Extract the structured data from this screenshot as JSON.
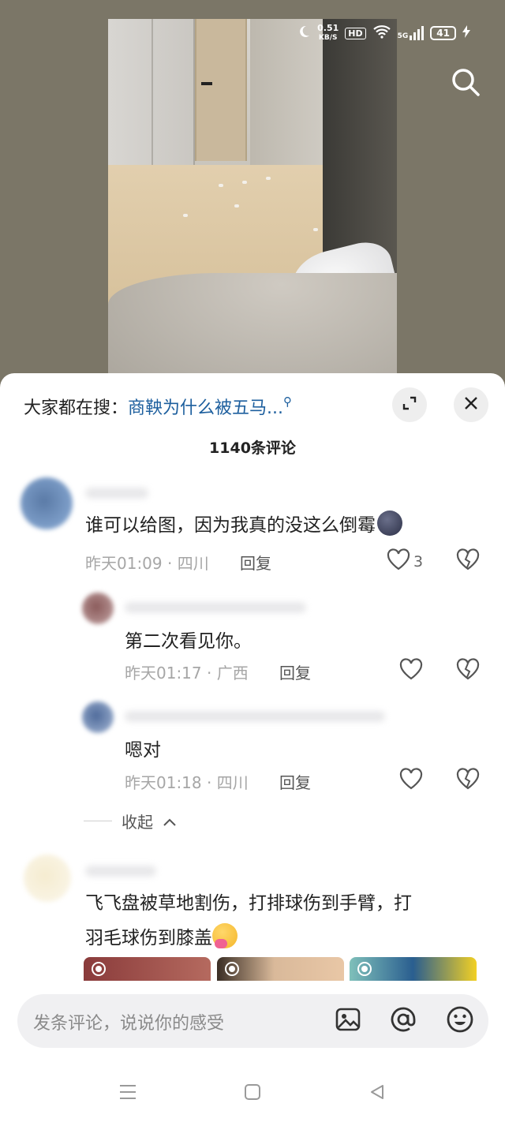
{
  "status_bar": {
    "net_speed": "0.51",
    "net_unit": "KB/S",
    "hd": "HD",
    "network": "5G",
    "battery": "41"
  },
  "sheet": {
    "trending_label": "大家都在搜：",
    "trending_query": "商鞅为什么被五马...",
    "comment_count": "1140条评论"
  },
  "comments": [
    {
      "text": "谁可以给图，因为我真的没这么倒霉",
      "time": "昨天01:09 · 四川",
      "reply_label": "回复",
      "likes": "3"
    },
    {
      "text": "第二次看见你。",
      "time": "昨天01:17 · 广西",
      "reply_label": "回复"
    },
    {
      "text": "嗯对",
      "time": "昨天01:18 · 四川",
      "reply_label": "回复"
    },
    {
      "text_line1": "飞飞盘被草地割伤，打排球伤到手臂，打",
      "text_line2": "羽毛球伤到膝盖"
    }
  ],
  "collapse_label": "收起",
  "input": {
    "placeholder": "发条评论，说说你的感受"
  },
  "colors": {
    "link_blue": "#1d5f9e",
    "meta_gray": "#a6a6a6",
    "sheet_bg": "#ffffff"
  },
  "icons": [
    "search-icon",
    "expand-icon",
    "close-icon",
    "heart-icon",
    "broken-heart-icon",
    "chevron-up-icon",
    "image-icon",
    "at-icon",
    "emoji-icon",
    "menu-icon",
    "home-icon",
    "back-icon"
  ]
}
